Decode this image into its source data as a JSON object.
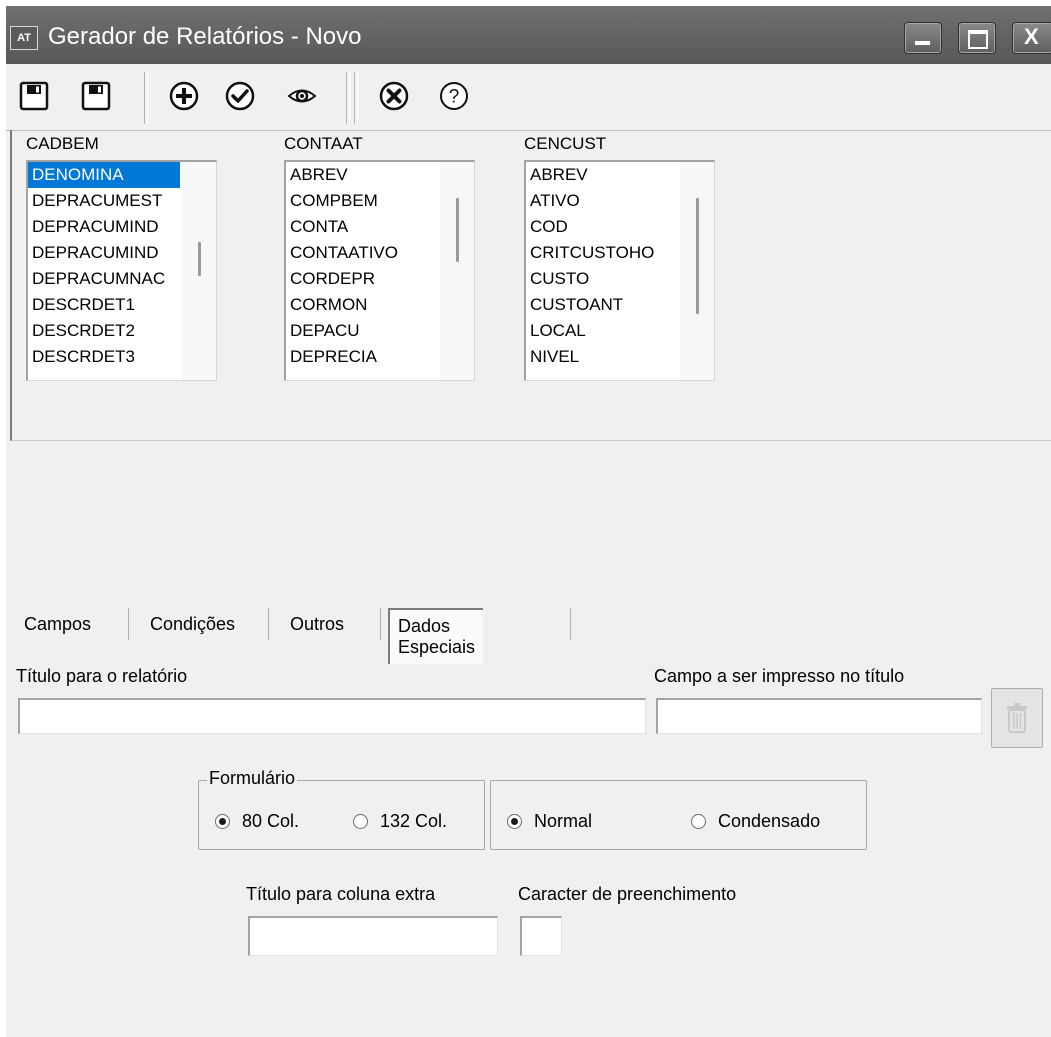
{
  "window": {
    "app_icon": "AT",
    "title": "Gerador de Relatórios - Novo",
    "buttons": {
      "minimize": "minimize-icon",
      "maximize": "maximize-icon",
      "close": "X"
    }
  },
  "toolbar": {
    "icons": [
      "save-icon",
      "save-as-icon",
      "add-icon",
      "confirm-icon",
      "preview-icon",
      "cancel-icon",
      "help-icon"
    ]
  },
  "tables": [
    {
      "name": "CADBEM",
      "fields": [
        "DENOMINA",
        "DEPRACUMEST",
        "DEPRACUMIND",
        "DEPRACUMIND",
        "DEPRACUMNAC",
        "DESCRDET1",
        "DESCRDET2",
        "DESCRDET3"
      ],
      "selected": 0
    },
    {
      "name": "CONTAAT",
      "fields": [
        "ABREV",
        "COMPBEM",
        "CONTA",
        "CONTAATIVO",
        "CORDEPR",
        "CORMON",
        "DEPACU",
        "DEPRECIA"
      ]
    },
    {
      "name": "CENCUST",
      "fields": [
        "ABREV",
        "ATIVO",
        "COD",
        "CRITCUSTOHO",
        "CUSTO",
        "CUSTOANT",
        "LOCAL",
        "NIVEL"
      ]
    }
  ],
  "tabs": [
    {
      "label": "Campos"
    },
    {
      "label": "Condições"
    },
    {
      "label": "Outros"
    },
    {
      "label": "Dados Especiais",
      "active": true
    }
  ],
  "form": {
    "report_title_label": "Título para o relatório",
    "report_title_value": "",
    "title_field_label": "Campo a ser impresso no título",
    "title_field_value": "",
    "delete_icon": "trash-icon",
    "formulario_label": "Formulário",
    "col80_label": "80 Col.",
    "col132_label": "132 Col.",
    "columns_selected": "80 Col.",
    "normal_label": "Normal",
    "condensado_label": "Condensado",
    "print_mode_selected": "Normal",
    "extra_column_label": "Título para coluna extra",
    "extra_column_value": "",
    "fill_char_label": "Caracter de preenchimento",
    "fill_char_value": ""
  }
}
